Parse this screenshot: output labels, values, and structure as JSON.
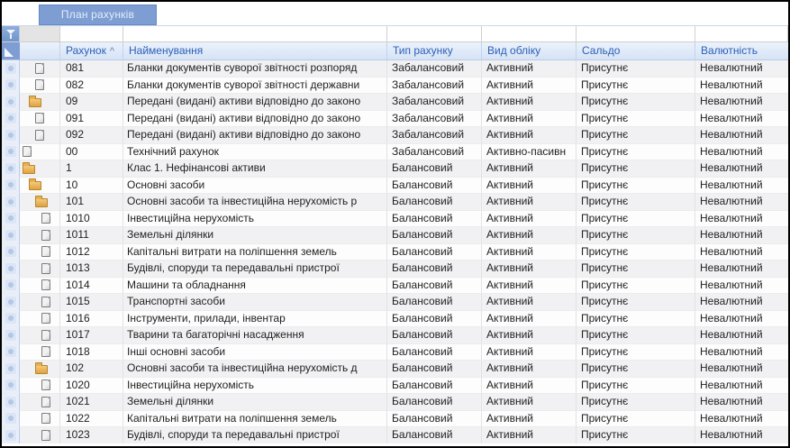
{
  "app": {
    "tab_label": "План рахунків"
  },
  "colors": {
    "tab_bg": "#7e9ed3",
    "tab_border": "#6288c4",
    "header_text": "#2d60b8",
    "header_bg_top": "#ebf2fb",
    "header_bg_bottom": "#d6e3f6",
    "folder_icon": "#e0a23e",
    "gutter_bg": "#e9effa",
    "row_alt_bg": "#f1f1f3"
  },
  "icons": {
    "filter_funnel": "funnel-icon",
    "select_all_corner": "corner-triangle-icon",
    "row_marker": "row-marker-icon",
    "group": "folder-icon",
    "leaf": "document-icon"
  },
  "table": {
    "sort_indicator": "^",
    "headers": {
      "account": "Рахунок",
      "name": "Найменування",
      "type": "Тип рахунку",
      "kind": "Вид обліку",
      "balance": "Сальдо",
      "currency": "Валютність"
    },
    "rows": [
      {
        "icon": "document",
        "level": 2,
        "account": "081",
        "name": "Бланки документів суворої звітності розпоряд",
        "type": "Забалансовий",
        "kind": "Активний",
        "balance": "Присутнє",
        "currency": "Невалютний"
      },
      {
        "icon": "document",
        "level": 2,
        "account": "082",
        "name": "Бланки документів суворої звітності державни",
        "type": "Забалансовий",
        "kind": "Активний",
        "balance": "Присутнє",
        "currency": "Невалютний"
      },
      {
        "icon": "folder",
        "level": 1,
        "account": "09",
        "name": "Передані (видані) активи відповідно до законо",
        "type": "Забалансовий",
        "kind": "Активний",
        "balance": "Присутнє",
        "currency": "Невалютний"
      },
      {
        "icon": "document",
        "level": 2,
        "account": "091",
        "name": "Передані (видані) активи відповідно до законо",
        "type": "Забалансовий",
        "kind": "Активний",
        "balance": "Присутнє",
        "currency": "Невалютний"
      },
      {
        "icon": "document",
        "level": 2,
        "account": "092",
        "name": "Передані (видані) активи відповідно до законо",
        "type": "Забалансовий",
        "kind": "Активний",
        "balance": "Присутнє",
        "currency": "Невалютний"
      },
      {
        "icon": "document",
        "level": 0,
        "account": "00",
        "name": "Технічний рахунок",
        "type": "Забалансовий",
        "kind": "Активно-пасивн",
        "balance": "Присутнє",
        "currency": "Невалютний"
      },
      {
        "icon": "folder",
        "level": 0,
        "account": "1",
        "name": "Клас 1. Нефінансові активи",
        "type": "Балансовий",
        "kind": "Активний",
        "balance": "Присутнє",
        "currency": "Невалютний"
      },
      {
        "icon": "folder",
        "level": 1,
        "account": "10",
        "name": "Основні засоби",
        "type": "Балансовий",
        "kind": "Активний",
        "balance": "Присутнє",
        "currency": "Невалютний"
      },
      {
        "icon": "folder",
        "level": 2,
        "account": "101",
        "name": "Основні засоби та інвестиційна нерухомість р",
        "type": "Балансовий",
        "kind": "Активний",
        "balance": "Присутнє",
        "currency": "Невалютний"
      },
      {
        "icon": "document",
        "level": 3,
        "account": "1010",
        "name": "Інвестиційна нерухомість",
        "type": "Балансовий",
        "kind": "Активний",
        "balance": "Присутнє",
        "currency": "Невалютний"
      },
      {
        "icon": "document",
        "level": 3,
        "account": "1011",
        "name": "Земельні ділянки",
        "type": "Балансовий",
        "kind": "Активний",
        "balance": "Присутнє",
        "currency": "Невалютний"
      },
      {
        "icon": "document",
        "level": 3,
        "account": "1012",
        "name": "Капітальні витрати на поліпшення земель",
        "type": "Балансовий",
        "kind": "Активний",
        "balance": "Присутнє",
        "currency": "Невалютний"
      },
      {
        "icon": "document",
        "level": 3,
        "account": "1013",
        "name": "Будівлі, споруди та передавальні пристрої",
        "type": "Балансовий",
        "kind": "Активний",
        "balance": "Присутнє",
        "currency": "Невалютний"
      },
      {
        "icon": "document",
        "level": 3,
        "account": "1014",
        "name": "Машини та обладнання",
        "type": "Балансовий",
        "kind": "Активний",
        "balance": "Присутнє",
        "currency": "Невалютний"
      },
      {
        "icon": "document",
        "level": 3,
        "account": "1015",
        "name": "Транспортні засоби",
        "type": "Балансовий",
        "kind": "Активний",
        "balance": "Присутнє",
        "currency": "Невалютний"
      },
      {
        "icon": "document",
        "level": 3,
        "account": "1016",
        "name": "Інструменти, прилади, інвентар",
        "type": "Балансовий",
        "kind": "Активний",
        "balance": "Присутнє",
        "currency": "Невалютний"
      },
      {
        "icon": "document",
        "level": 3,
        "account": "1017",
        "name": "Тварини та багаторічні насадження",
        "type": "Балансовий",
        "kind": "Активний",
        "balance": "Присутнє",
        "currency": "Невалютний"
      },
      {
        "icon": "document",
        "level": 3,
        "account": "1018",
        "name": "Інші основні засоби",
        "type": "Балансовий",
        "kind": "Активний",
        "balance": "Присутнє",
        "currency": "Невалютний"
      },
      {
        "icon": "folder",
        "level": 2,
        "account": "102",
        "name": "Основні засоби та інвестиційна нерухомість д",
        "type": "Балансовий",
        "kind": "Активний",
        "balance": "Присутнє",
        "currency": "Невалютний"
      },
      {
        "icon": "document",
        "level": 3,
        "account": "1020",
        "name": "Інвестиційна нерухомість",
        "type": "Балансовий",
        "kind": "Активний",
        "balance": "Присутнє",
        "currency": "Невалютний"
      },
      {
        "icon": "document",
        "level": 3,
        "account": "1021",
        "name": "Земельні ділянки",
        "type": "Балансовий",
        "kind": "Активний",
        "balance": "Присутнє",
        "currency": "Невалютний"
      },
      {
        "icon": "document",
        "level": 3,
        "account": "1022",
        "name": "Капітальні витрати на поліпшення земель",
        "type": "Балансовий",
        "kind": "Активний",
        "balance": "Присутнє",
        "currency": "Невалютний"
      },
      {
        "icon": "document",
        "level": 3,
        "account": "1023",
        "name": "Будівлі, споруди та передавальні пристрої",
        "type": "Балансовий",
        "kind": "Активний",
        "balance": "Присутнє",
        "currency": "Невалютний"
      }
    ]
  }
}
